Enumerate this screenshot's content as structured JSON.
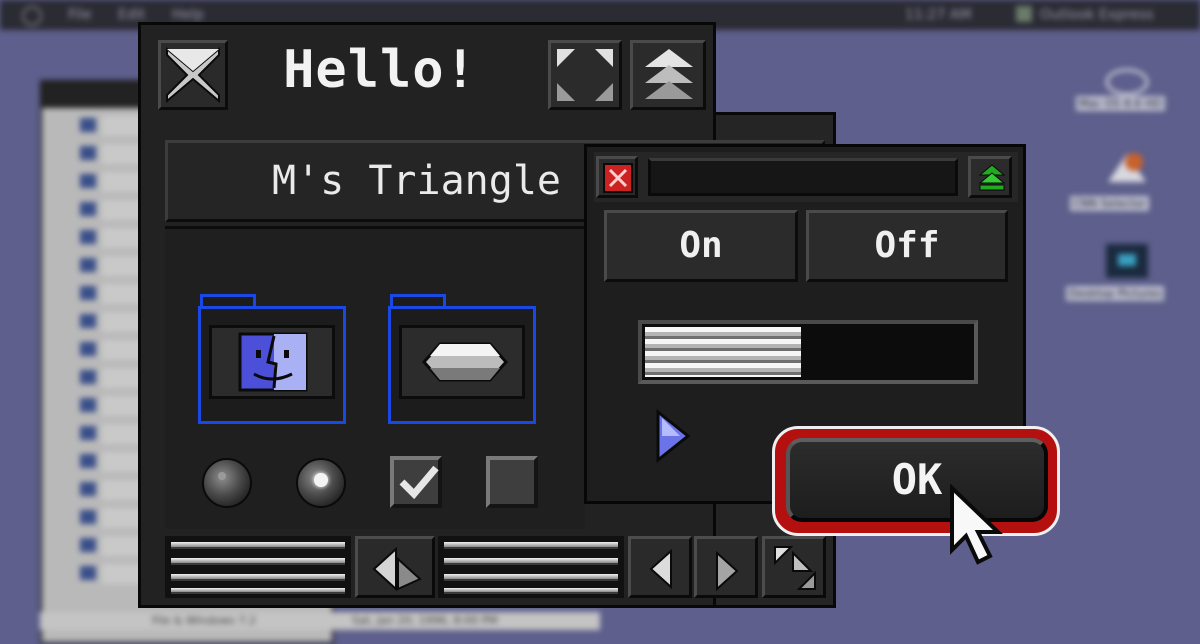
{
  "menubar": {
    "menus": [
      "File",
      "Edit",
      "Help"
    ],
    "clock": "11:27 AM",
    "app_name": "Outlook Express"
  },
  "desktop": {
    "icons": [
      {
        "name": "Mac OS 8.6 HD"
      },
      {
        "name": "CNN Selector"
      },
      {
        "name": "Desktop Pictures"
      }
    ]
  },
  "status_bar": {
    "item": "File & Windows 7.2",
    "date": "Sat, Jan 20, 1996, 8:00 PM"
  },
  "main_window": {
    "title": "Hello!",
    "name_field": "M's Triangle G",
    "radio_buttons": [
      {
        "state": "unselected"
      },
      {
        "state": "selected"
      }
    ],
    "checkboxes": [
      {
        "state": "checked"
      },
      {
        "state": "unchecked"
      }
    ]
  },
  "dialog": {
    "on_label": "On",
    "off_label": "Off",
    "progress_percent": 48,
    "ok_label": "OK"
  },
  "colors": {
    "desktop": "#5e5f8c",
    "window": "#222222",
    "folder_outline": "#1a48e6",
    "ok_ring": "#b41010",
    "close_box": "#cc2222",
    "collapse_box": "#22aa22"
  }
}
